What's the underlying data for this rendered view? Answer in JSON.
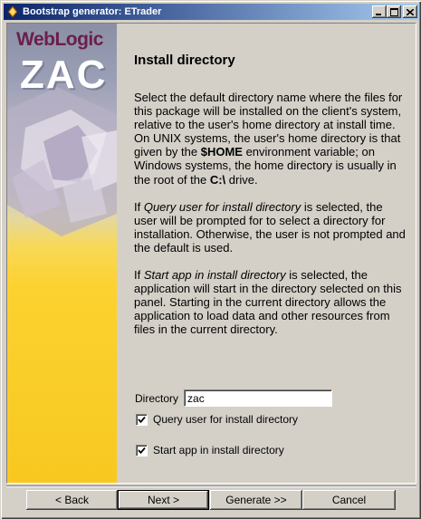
{
  "window": {
    "title": "Bootstrap generator: ETrader"
  },
  "brand": {
    "line1": "WebLogic",
    "line2": "ZAC"
  },
  "page": {
    "heading": "Install directory",
    "para1_a": "Select the default directory name where the files for this package will be installed on the client's system, relative to the user's home directory at install time. On UNIX systems, the user's home directory is that given by the ",
    "para1_home": "$HOME",
    "para1_b": " environment variable; on Windows systems, the home directory is usually in the root of the ",
    "para1_drive": "C:\\",
    "para1_c": " drive.",
    "para2_a": "If ",
    "para2_italic": "Query user for install directory",
    "para2_b": " is selected, the user will be prompted for to select a directory for installation. Otherwise, the user is not prompted and the default is used.",
    "para3_a": "If ",
    "para3_italic": "Start app in install directory",
    "para3_b": " is selected, the application will start in the directory selected on this panel. Starting in the current directory allows the application to load data and other resources from files in the current directory."
  },
  "form": {
    "directory_label": "Directory",
    "directory_value": "zac",
    "query_user_label": "Query user for install directory",
    "query_user_checked": true,
    "start_app_label": "Start app in install directory",
    "start_app_checked": true
  },
  "buttons": {
    "back": "< Back",
    "next": "Next >",
    "generate": "Generate >>",
    "cancel": "Cancel"
  },
  "icons": {
    "app": "java-cup-icon",
    "minimize": "minimize-icon",
    "maximize": "maximize-icon",
    "close": "close-icon",
    "check": "checkmark-icon"
  },
  "colors": {
    "titlebar_start": "#0a246a",
    "titlebar_end": "#a6caf0",
    "face": "#d4d0c8",
    "brand_purple": "#6b1e4a",
    "banner_yellow": "#fcd230"
  }
}
